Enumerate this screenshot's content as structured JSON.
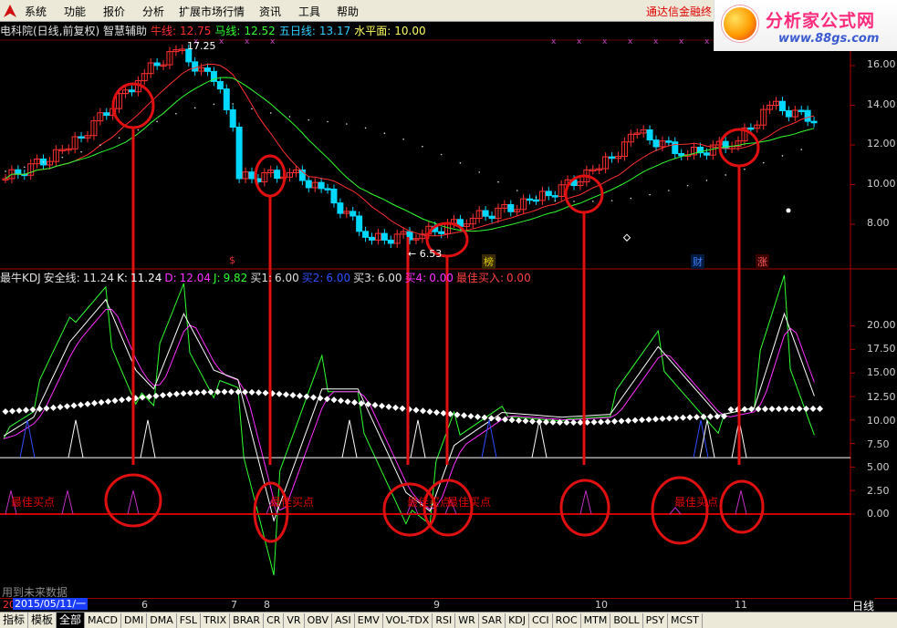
{
  "menu": {
    "items": [
      "系统",
      "功能",
      "报价",
      "分析",
      "扩展市场行情",
      "资讯",
      "工具",
      "帮助"
    ],
    "ad_text": "通达信金融终",
    "logo_title": "分析家公式网",
    "logo_url": "www.88gs.com"
  },
  "kline_header": {
    "stock": "电科院(日线,前复权) 智慧辅助",
    "ma1_label": "牛线:",
    "ma1_value": "12.75",
    "ma2_label": "马线:",
    "ma2_value": "12.52",
    "ma3_label": "五日线:",
    "ma3_value": "13.17",
    "level_label": "水平面:",
    "level_value": "10.00",
    "high_note": "17.25",
    "low_note": "← 6.53"
  },
  "kline_axis": [
    "16.00",
    "14.00",
    "12.00",
    "10.00",
    "8.00"
  ],
  "kline_tags": [
    {
      "text": "$",
      "color": "#e03030"
    },
    {
      "text": "榜",
      "color": "#e0d000"
    },
    {
      "text": "财",
      "color": "#4080ff"
    },
    {
      "text": "涨",
      "color": "#ff6060"
    }
  ],
  "indicator_header": {
    "name": "最牛KDJ",
    "safe_label": "安全线:",
    "safe_value": "11.24",
    "k_label": "K:",
    "k_value": "11.24",
    "d_label": "D:",
    "d_value": "12.04",
    "j_label": "J:",
    "j_value": "9.82",
    "b1_label": "买1:",
    "b1_value": "6.00",
    "b2_label": "买2:",
    "b2_value": "6.00",
    "b3_label": "买3:",
    "b3_value": "6.00",
    "b4_label": "买4:",
    "b4_value": "0.00",
    "best_label": "最佳买入:",
    "best_value": "0.00"
  },
  "indicator_axis": [
    "20.00",
    "17.50",
    "15.00",
    "12.50",
    "10.00",
    "7.50",
    "5.00",
    "2.50",
    "0.00"
  ],
  "buy_labels": [
    "最佳买点",
    "最佳买点",
    "最佳买点",
    "最佳买点",
    "最佳买点"
  ],
  "future_note": "用到未来数据",
  "time_axis": {
    "date_box": "2015/05/11/一",
    "months": [
      "6",
      "7",
      "8",
      "9",
      "10",
      "11"
    ],
    "period": "日线"
  },
  "tabs": [
    "指标",
    "模板",
    "全部",
    "MACD",
    "DMI",
    "DMA",
    "FSL",
    "TRIX",
    "BRAR",
    "CR",
    "VR",
    "OBV",
    "ASI",
    "EMV",
    "VOL-TDX",
    "RSI",
    "WR",
    "SAR",
    "KDJ",
    "CCI",
    "ROC",
    "MTM",
    "BOLL",
    "PSY",
    "MCST"
  ],
  "colors": {
    "up": "#ff3030",
    "down": "#00d8ff",
    "ma1": "#ff3030",
    "ma2": "#30ff30",
    "k": "#ffffff",
    "d": "#ff30ff",
    "j": "#30ff30",
    "circle": "#e01010"
  }
}
